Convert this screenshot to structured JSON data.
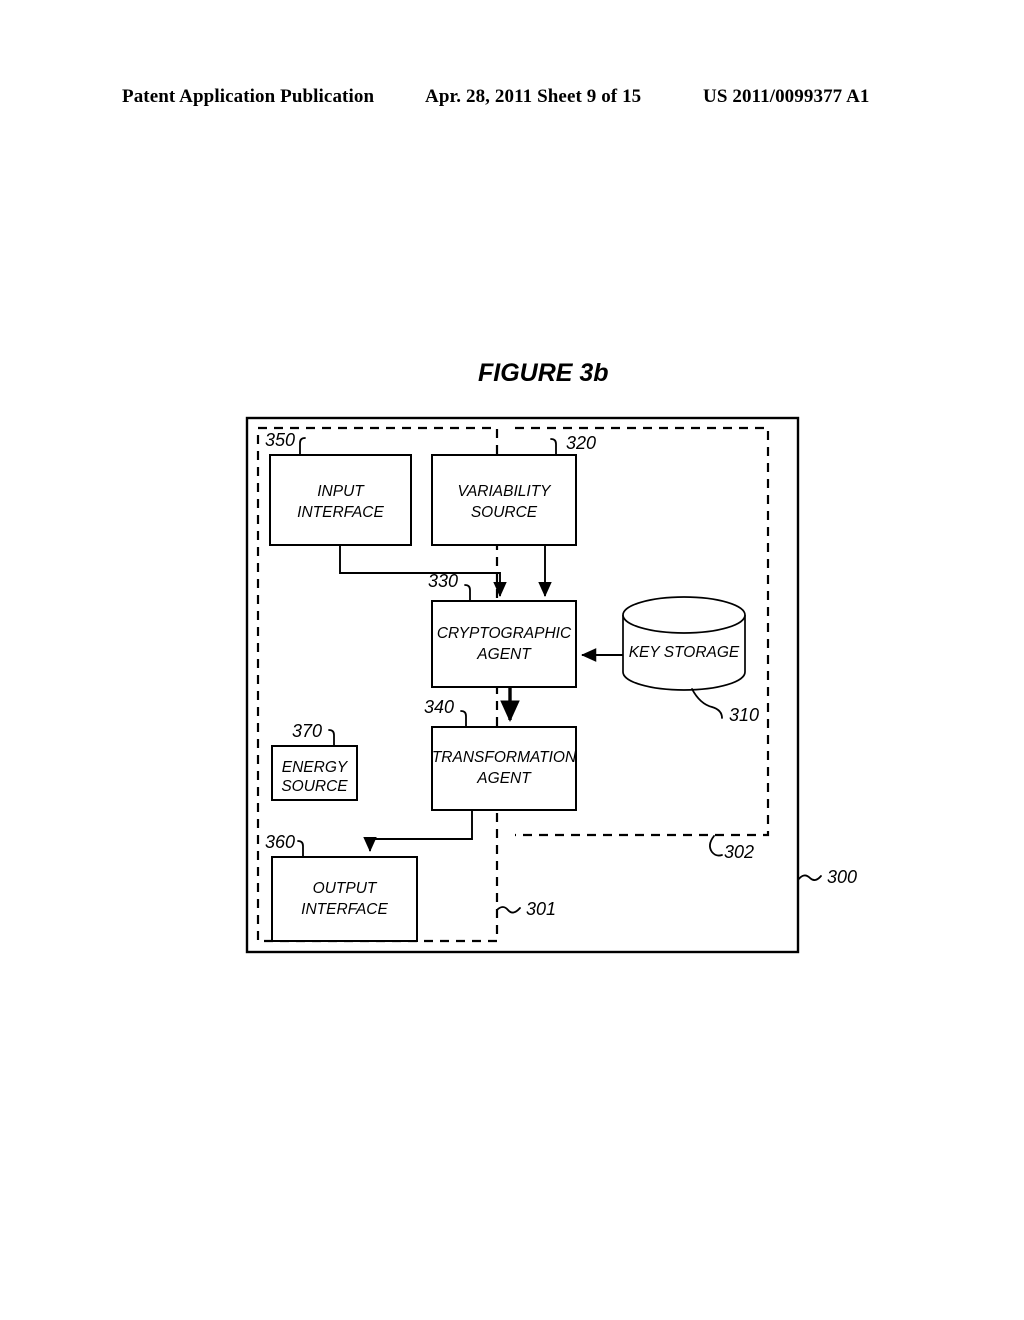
{
  "header": {
    "left": "Patent Application Publication",
    "middle": "Apr. 28, 2011  Sheet 9 of 15",
    "right": "US 2011/0099377 A1"
  },
  "figure": {
    "title": "FIGURE 3b",
    "boxes": [
      {
        "id": "input-interface",
        "ref": "350",
        "line1": "INPUT",
        "line2": "INTERFACE"
      },
      {
        "id": "variability-source",
        "ref": "320",
        "line1": "VARIABILITY",
        "line2": "SOURCE"
      },
      {
        "id": "cryptographic-agent",
        "ref": "330",
        "line1": "CRYPTOGRAPHIC",
        "line2": "AGENT"
      },
      {
        "id": "transformation-agent",
        "ref": "340",
        "line1": "TRANSFORMATION",
        "line2": "AGENT"
      },
      {
        "id": "energy-source",
        "ref": "370",
        "line1": "ENERGY",
        "line2": "SOURCE"
      },
      {
        "id": "output-interface",
        "ref": "360",
        "line1": "OUTPUT",
        "line2": "INTERFACE"
      },
      {
        "id": "key-storage",
        "ref": "310",
        "line1": "KEY STORAGE",
        "line2": ""
      }
    ],
    "regions": [
      {
        "id": "region-301",
        "ref": "301"
      },
      {
        "id": "region-302",
        "ref": "302"
      },
      {
        "id": "outer-frame-300",
        "ref": "300"
      }
    ],
    "colors": {
      "ink": "#000000",
      "paper": "#ffffff"
    }
  }
}
